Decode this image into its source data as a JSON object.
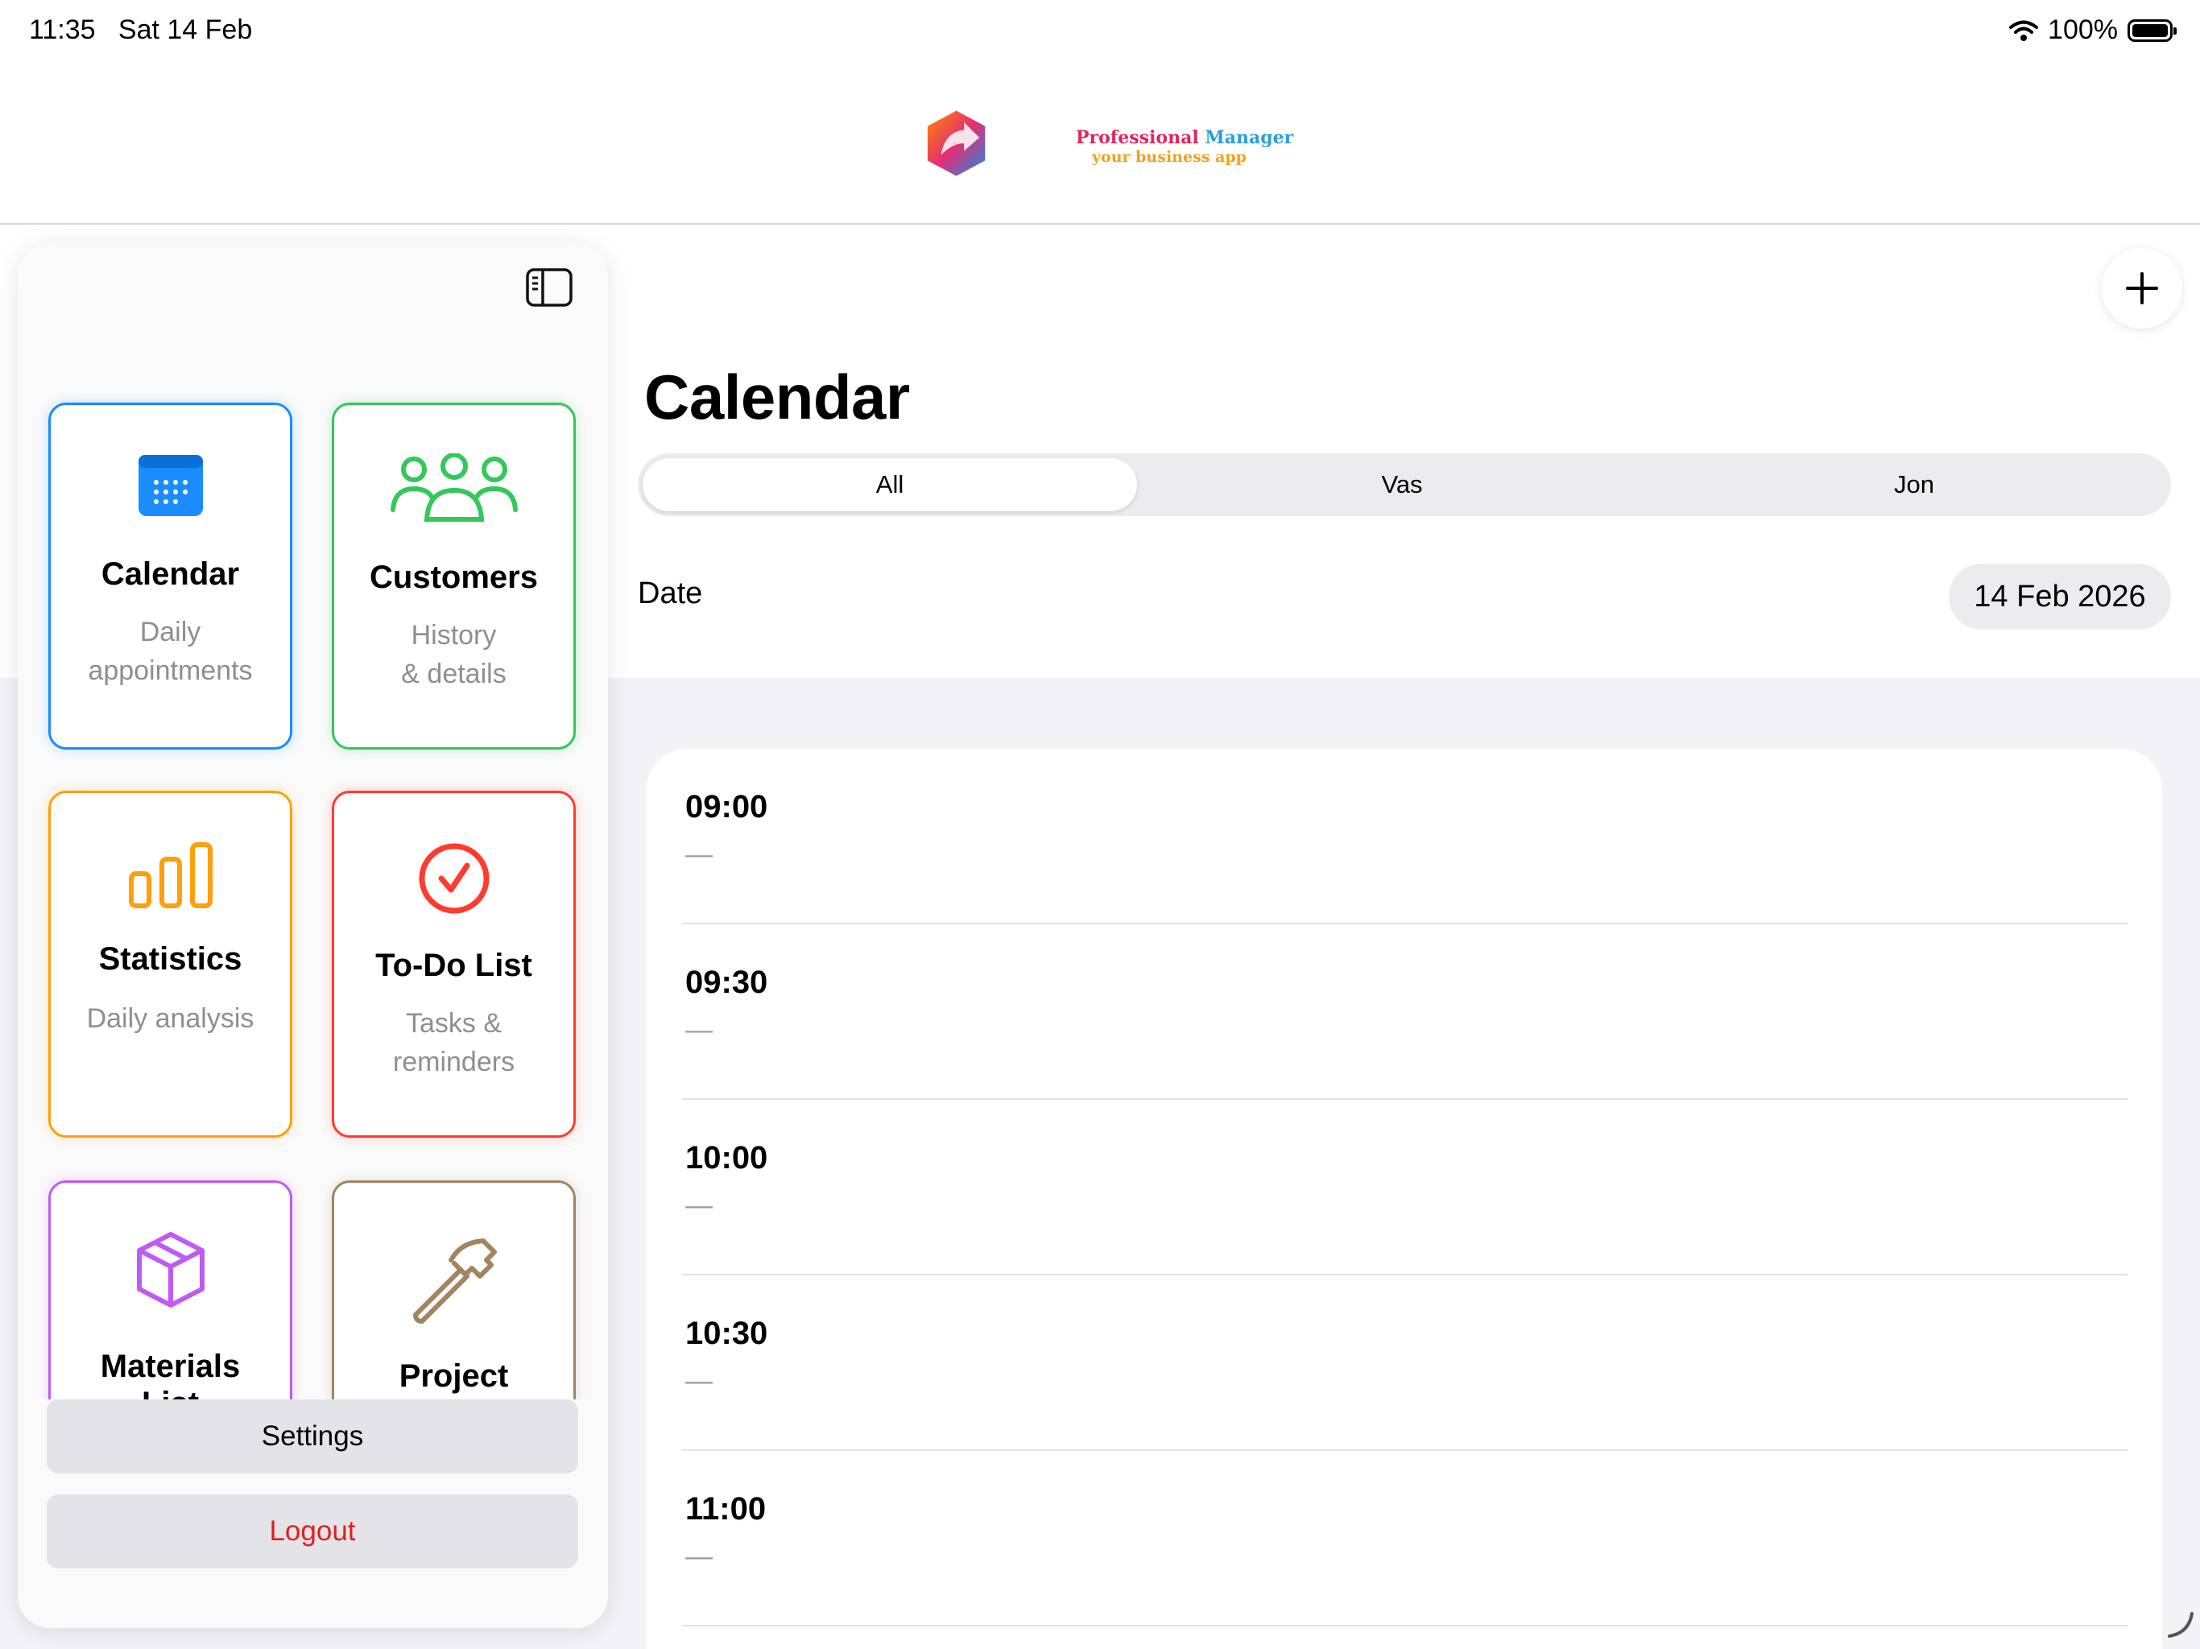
{
  "status_bar": {
    "time": "11:35",
    "date": "Sat 14 Feb",
    "battery": "100%"
  },
  "logo": {
    "line1_part1": "Professional",
    "line1_part2": "Manager",
    "line2": "your business app"
  },
  "main": {
    "title": "Calendar",
    "add_icon": "plus-icon",
    "segments": [
      {
        "label": "All",
        "selected": true
      },
      {
        "label": "Vas",
        "selected": false
      },
      {
        "label": "Jon",
        "selected": false
      }
    ],
    "date_label": "Date",
    "date_value": "14 Feb 2026",
    "slots": [
      {
        "time": "09:00",
        "value": "—"
      },
      {
        "time": "09:30",
        "value": "—"
      },
      {
        "time": "10:00",
        "value": "—"
      },
      {
        "time": "10:30",
        "value": "—"
      },
      {
        "time": "11:00",
        "value": "—"
      }
    ]
  },
  "sidebar": {
    "toggle_icon": "sidebar-toggle-icon",
    "tiles": [
      {
        "title": "Calendar",
        "subtitle_1": "Daily",
        "subtitle_2": "appointments",
        "icon": "calendar-icon",
        "color": "#1a8cff"
      },
      {
        "title": "Customers",
        "subtitle_1": "History",
        "subtitle_2": "& details",
        "icon": "people-icon",
        "color": "#34c759"
      },
      {
        "title": "Statistics",
        "subtitle_1": "Daily analysis",
        "icon": "chart-icon",
        "color": "#ff9f0a"
      },
      {
        "title": "To-Do List",
        "subtitle_1": "Tasks &",
        "subtitle_2": "reminders",
        "icon": "checkmark-circle-icon",
        "color": "#ff3b30"
      },
      {
        "title": "Materials",
        "title_2": "List",
        "icon": "box-icon",
        "color": "#bf5af2"
      },
      {
        "title": "Project",
        "icon": "hammer-icon",
        "color": "#a2845e"
      }
    ],
    "settings_label": "Settings",
    "logout_label": "Logout",
    "logout_color": "#e02020"
  }
}
